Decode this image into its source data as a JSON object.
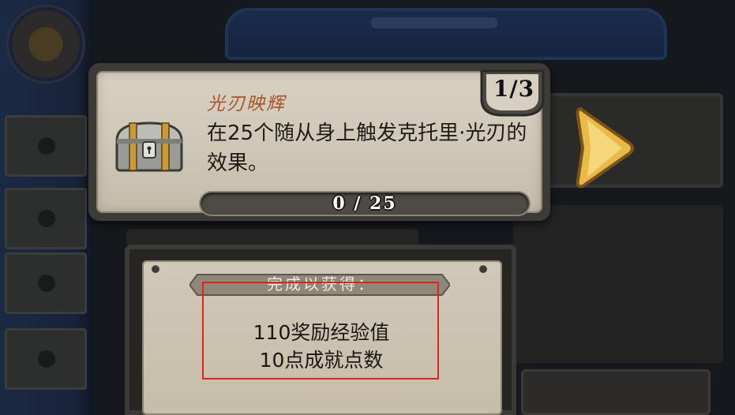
{
  "quest": {
    "title": "光刃映辉",
    "description": "在25个随从身上触发克托里·光刃的效果。",
    "progress": {
      "current": 0,
      "total": 25,
      "label": "0 / 25"
    },
    "page_indicator": "1/3"
  },
  "reward": {
    "header": "完成以获得：",
    "xp_line": "110奖励经验值",
    "points_line": "10点成就点数"
  },
  "icons": {
    "chest": "treasure-chest-icon",
    "next": "next-arrow-icon"
  },
  "colors": {
    "title": "#a7542c",
    "highlight_box": "#e02320",
    "arrow_gold": "#e9b94a"
  }
}
